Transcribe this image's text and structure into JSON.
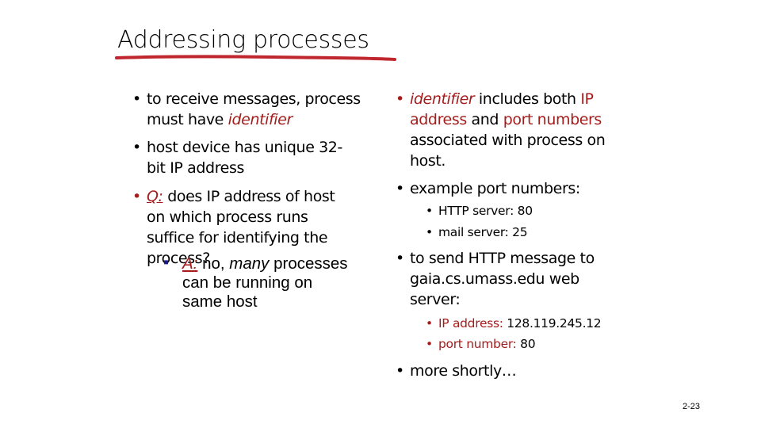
{
  "slide": {
    "title": "Addressing processes",
    "page_number": "2-23",
    "colors": {
      "accent_red": "#a51c1c",
      "answer_bullet": "#1a1a8c",
      "title_underline": "#c0262d"
    }
  },
  "left_column": {
    "bullet1": {
      "dot": "•",
      "line1": "to receive messages, process",
      "line2_prefix": "must have ",
      "line2_emph": "identifier"
    },
    "bullet2": {
      "dot": "•",
      "line1": "host device has unique 32-",
      "line2": "bit IP address"
    },
    "bullet3": {
      "dot": "•",
      "q_label": "Q:",
      "line1_rest": " does  IP address of host",
      "line2": "on which process runs",
      "line3": "suffice for identifying the",
      "line4": "process?"
    },
    "answer": {
      "dot": "▪",
      "a_label": "A:",
      "line1_a": " no, ",
      "line1_emph": "many",
      "line1_b": " processes",
      "line2": "can be running on",
      "line3": "same host"
    }
  },
  "right_column": {
    "bullet1": {
      "dot": "•",
      "emph": "identifier",
      "t1": " includes both ",
      "r1": "IP",
      "r2": "address",
      "t2": " and ",
      "r3": "port numbers",
      "line3": "associated with process on",
      "line4": "host."
    },
    "bullet2": {
      "dot": "•",
      "text": "example port numbers:"
    },
    "sub_ports": [
      {
        "dot": "•",
        "text": "HTTP server: 80"
      },
      {
        "dot": "•",
        "text": "mail server: 25"
      }
    ],
    "bullet3": {
      "dot": "•",
      "line1": "to send HTTP message to",
      "line2": "gaia.cs.umass.edu web",
      "line3": "server:"
    },
    "sub_example": [
      {
        "dot": "•",
        "label": "IP address:",
        "value": " 128.119.245.12"
      },
      {
        "dot": "•",
        "label": "port number:",
        "value": " 80"
      }
    ],
    "bullet4": {
      "dot": "•",
      "text": "more shortly…"
    }
  }
}
